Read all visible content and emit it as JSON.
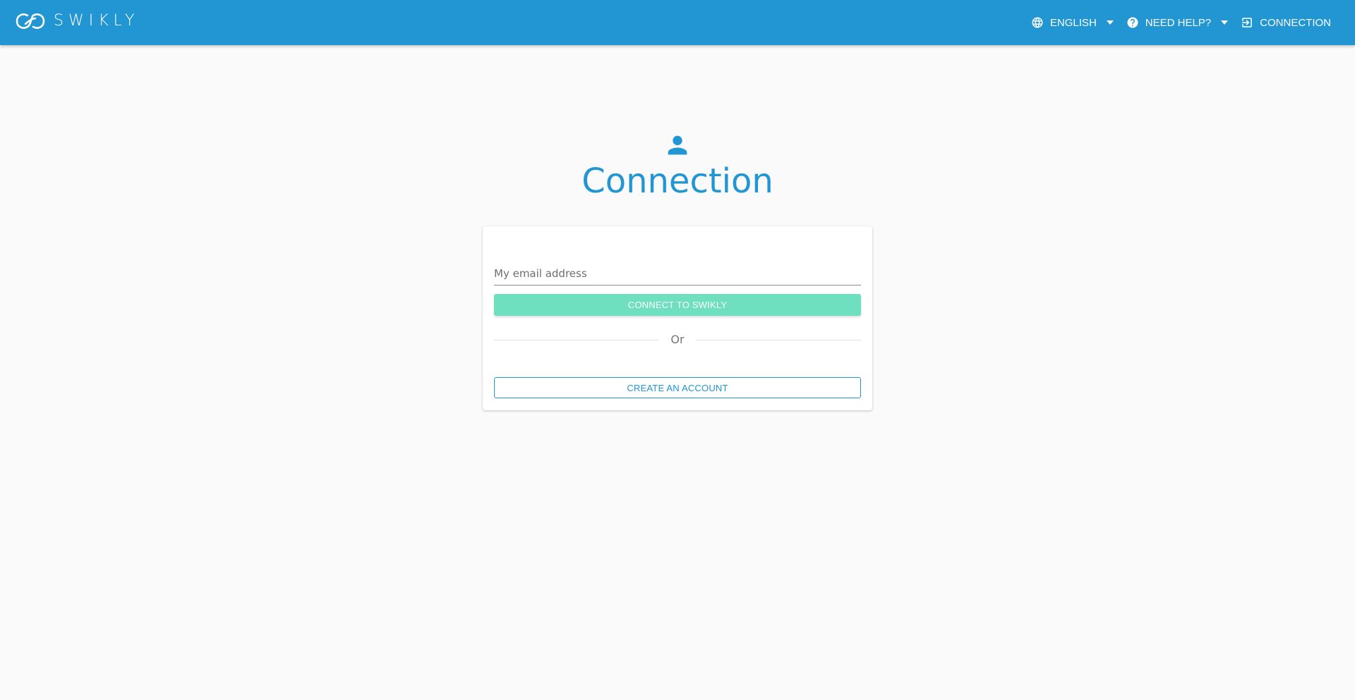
{
  "colors": {
    "primary": "#2196d3",
    "accent": "#6fe0bf",
    "background": "#fafafa"
  },
  "header": {
    "logo_text": "SWIKLY",
    "nav": {
      "language": {
        "label": "ENGLISH",
        "icon": "globe-icon"
      },
      "help": {
        "label": "NEED HELP?",
        "icon": "help-circle-icon"
      },
      "connection": {
        "label": "CONNECTION",
        "icon": "login-icon"
      }
    }
  },
  "main": {
    "icon": "person-icon",
    "title": "Connection",
    "form": {
      "email_placeholder": "My email address",
      "email_value": "",
      "connect_button": "CONNECT TO SWIKLY",
      "divider_text": "Or",
      "create_account_button": "CREATE AN ACCOUNT"
    }
  }
}
